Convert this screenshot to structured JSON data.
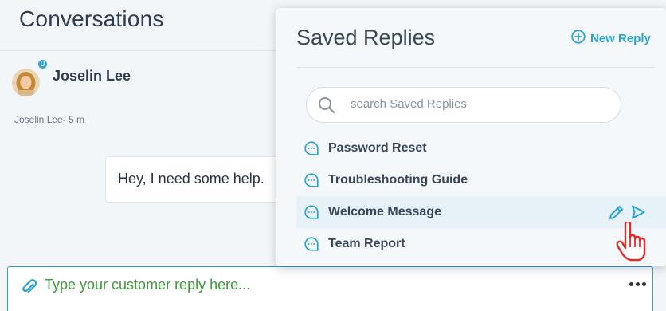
{
  "header": {
    "title": "Conversations"
  },
  "contact": {
    "name": "Joselin Lee",
    "badge": "U"
  },
  "message": {
    "meta": "Joselin Lee- 5 m",
    "text": "Hey, I need some help."
  },
  "composer": {
    "placeholder": "Type your customer reply here..."
  },
  "saved_replies": {
    "title": "Saved Replies",
    "new_reply_label": "New Reply",
    "search_placeholder": "search Saved Replies",
    "items": [
      {
        "label": "Password Reset"
      },
      {
        "label": "Troubleshooting Guide"
      },
      {
        "label": "Welcome Message"
      },
      {
        "label": "Team Report"
      }
    ]
  },
  "colors": {
    "accent": "#2aa3d2",
    "composer_text": "#3d9a3b",
    "highlight_row": "#e6f2f8",
    "cursor_red": "#e32b2b"
  },
  "icons": [
    "paperclip-icon",
    "more-icon",
    "plus-circle-icon",
    "search-icon",
    "chat-bubble-icon",
    "pencil-icon",
    "send-icon",
    "hand-cursor-icon"
  ]
}
